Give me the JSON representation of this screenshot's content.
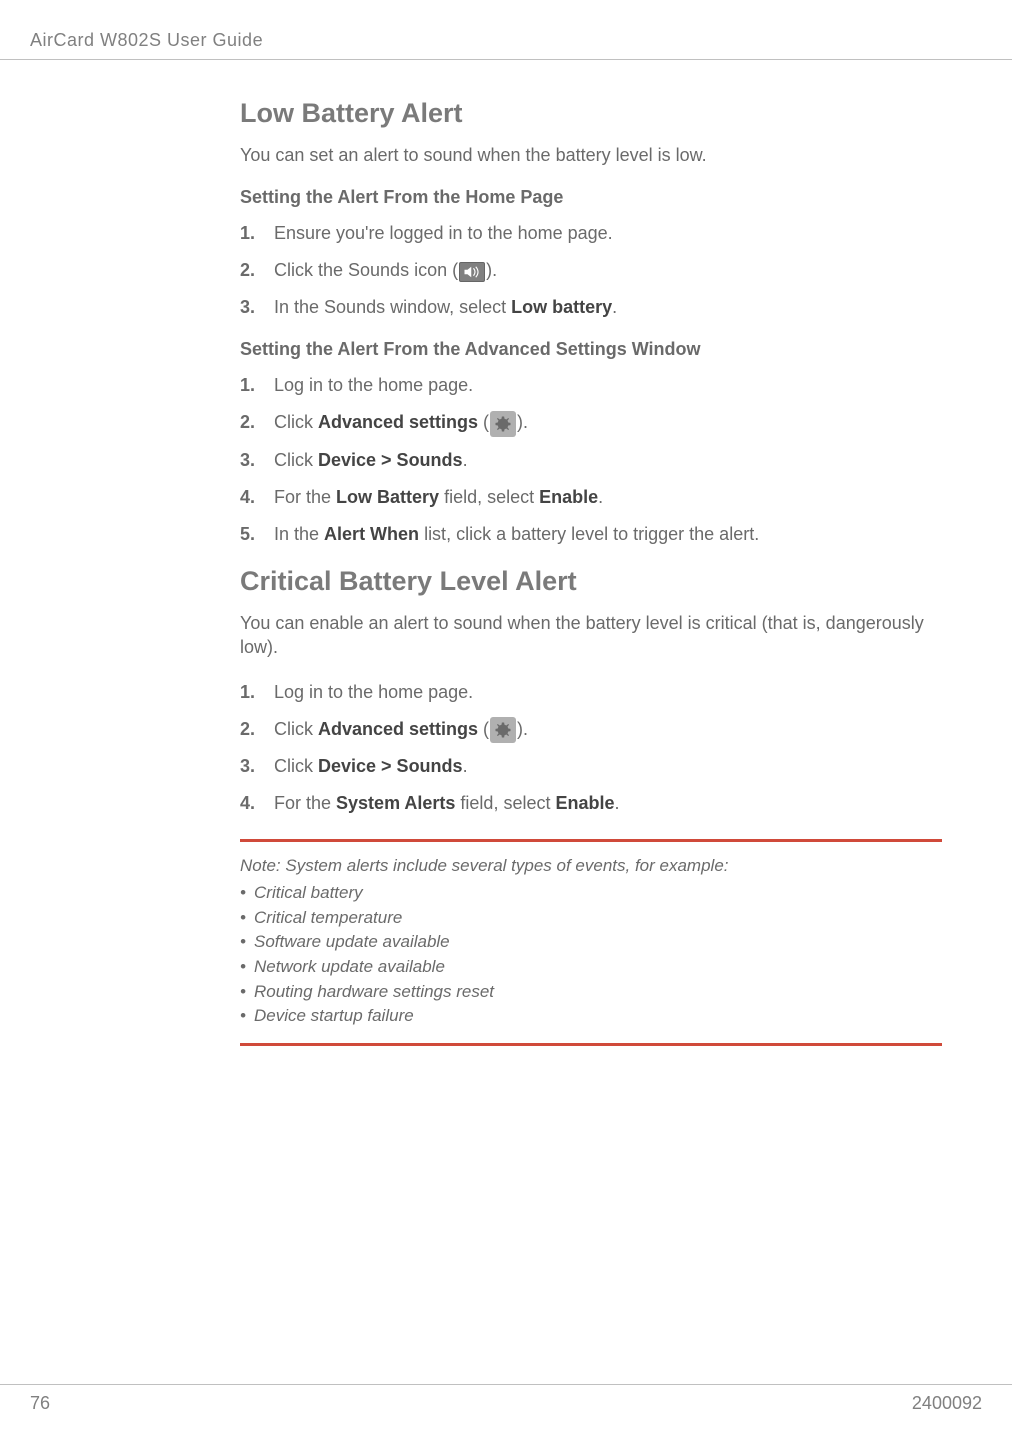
{
  "header": {
    "title": "AirCard W802S User Guide"
  },
  "sections": {
    "lowBattery": {
      "title": "Low Battery Alert",
      "intro": "You can set an alert to sound when the battery level is low.",
      "fromHome": {
        "heading": "Setting the Alert From the Home Page",
        "steps": {
          "s1": "Ensure you're logged in to the home page.",
          "s2_pre": "Click the Sounds icon (",
          "s2_post": ").",
          "s3_pre": "In the Sounds window, select ",
          "s3_bold": "Low battery",
          "s3_post": "."
        }
      },
      "fromAdvanced": {
        "heading": "Setting the Alert From the Advanced Settings Window",
        "steps": {
          "s1": "Log in to the home page.",
          "s2_pre": "Click ",
          "s2_bold": "Advanced settings",
          "s2_mid": " (",
          "s2_post": ").",
          "s3_pre": "Click ",
          "s3_bold": "Device > Sounds",
          "s3_post": ".",
          "s4_pre": "For the ",
          "s4_bold1": "Low Battery",
          "s4_mid": " field, select ",
          "s4_bold2": "Enable",
          "s4_post": ".",
          "s5_pre": "In the ",
          "s5_bold": "Alert When",
          "s5_post": " list, click a battery level to trigger the alert."
        }
      }
    },
    "critical": {
      "title": "Critical Battery Level Alert",
      "intro": "You can enable an alert to sound when the battery level is critical (that is, dangerously low).",
      "steps": {
        "s1": "Log in to the home page.",
        "s2_pre": "Click ",
        "s2_bold": "Advanced settings",
        "s2_mid": " (",
        "s2_post": ").",
        "s3_pre": "Click ",
        "s3_bold": "Device > Sounds",
        "s3_post": ".",
        "s4_pre": "For the ",
        "s4_bold1": "System Alerts",
        "s4_mid": " field, select ",
        "s4_bold2": "Enable",
        "s4_post": "."
      }
    }
  },
  "note": {
    "intro": "Note:  System alerts include several types of events, for example:",
    "items": {
      "i1": "Critical battery",
      "i2": "Critical temperature",
      "i3": "Software update available",
      "i4": "Network update available",
      "i5": "Routing hardware settings reset",
      "i6": "Device startup failure"
    }
  },
  "footer": {
    "page": "76",
    "docnum": "2400092"
  }
}
